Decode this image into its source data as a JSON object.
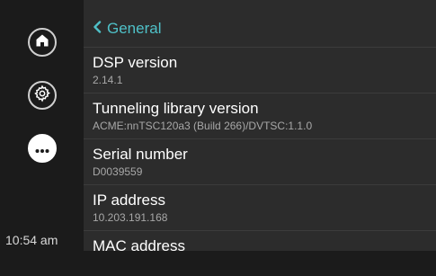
{
  "sidebar": {
    "items": [
      {
        "name": "home",
        "icon": "home-icon"
      },
      {
        "name": "settings",
        "icon": "gear-icon"
      },
      {
        "name": "more",
        "icon": "more-icon",
        "active": true
      }
    ],
    "time": "10:54 am"
  },
  "header": {
    "back_label": "General",
    "back_icon": "chevron-left-icon",
    "accent_color": "#4fc1c8"
  },
  "rows": [
    {
      "label": "DSP version",
      "value": "2.14.1"
    },
    {
      "label": "Tunneling library version",
      "value": "ACME:nnTSC120a3 (Build 266)/DVTSC:1.1.0"
    },
    {
      "label": "Serial number",
      "value": "D0039559"
    },
    {
      "label": "IP address",
      "value": "10.203.191.168"
    },
    {
      "label": "MAC address",
      "value": ""
    }
  ]
}
